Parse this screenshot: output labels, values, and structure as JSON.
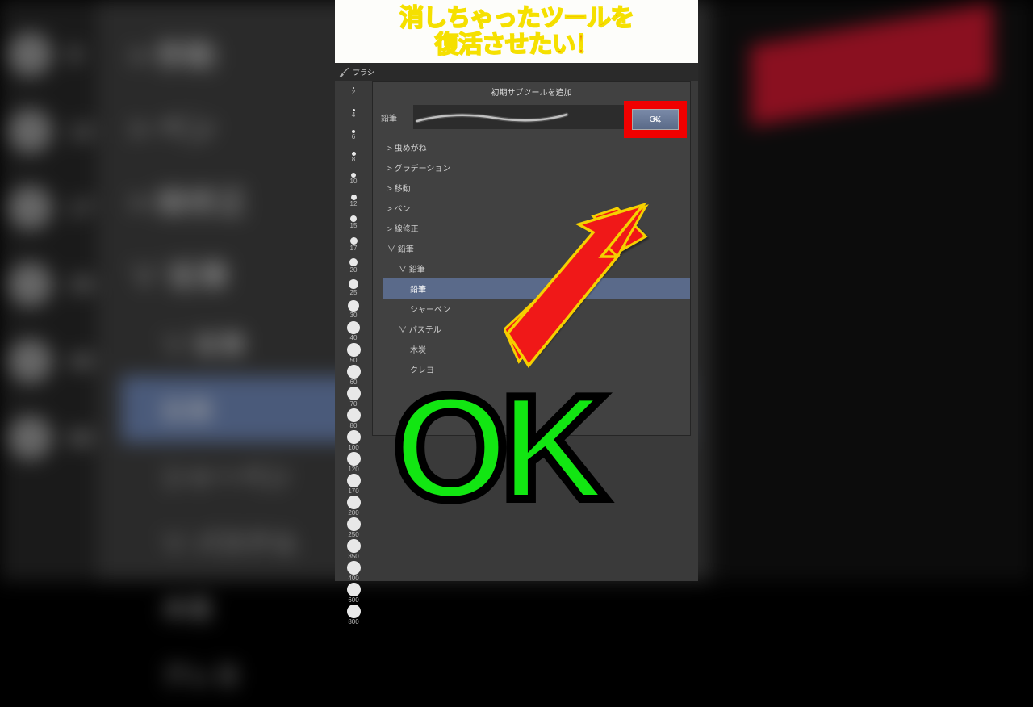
{
  "banner": {
    "line1": "消しちゃったツールを",
    "line2": "復活させたい！"
  },
  "tab": {
    "label": "ブラシ"
  },
  "dialog": {
    "title": "初期サブツールを追加",
    "preview_label": "鉛筆",
    "ok_label": "OK"
  },
  "tree": [
    {
      "label": "> 虫めがね",
      "indent": 0,
      "sel": false
    },
    {
      "label": "> グラデーション",
      "indent": 0,
      "sel": false
    },
    {
      "label": "> 移動",
      "indent": 0,
      "sel": false
    },
    {
      "label": "> ペン",
      "indent": 0,
      "sel": false
    },
    {
      "label": "> 線修正",
      "indent": 0,
      "sel": false
    },
    {
      "label": "∨ 鉛筆",
      "indent": 0,
      "sel": false
    },
    {
      "label": "∨ 鉛筆",
      "indent": 1,
      "sel": false
    },
    {
      "label": "鉛筆",
      "indent": 2,
      "sel": true
    },
    {
      "label": "シャーペン",
      "indent": 2,
      "sel": false
    },
    {
      "label": "∨ パステル",
      "indent": 1,
      "sel": false
    },
    {
      "label": "木炭",
      "indent": 2,
      "sel": false
    },
    {
      "label": "クレヨ",
      "indent": 2,
      "sel": false
    }
  ],
  "sizes": [
    {
      "n": "2",
      "d": 2
    },
    {
      "n": "4",
      "d": 3
    },
    {
      "n": "6",
      "d": 4
    },
    {
      "n": "8",
      "d": 5
    },
    {
      "n": "10",
      "d": 6
    },
    {
      "n": "12",
      "d": 7
    },
    {
      "n": "15",
      "d": 8
    },
    {
      "n": "17",
      "d": 9
    },
    {
      "n": "20",
      "d": 10
    },
    {
      "n": "25",
      "d": 12
    },
    {
      "n": "30",
      "d": 14
    },
    {
      "n": "40",
      "d": 16
    },
    {
      "n": "50",
      "d": 17
    },
    {
      "n": "60",
      "d": 17
    },
    {
      "n": "70",
      "d": 17
    },
    {
      "n": "80",
      "d": 17
    },
    {
      "n": "100",
      "d": 17
    },
    {
      "n": "120",
      "d": 17
    },
    {
      "n": "170",
      "d": 17
    },
    {
      "n": "200",
      "d": 17
    },
    {
      "n": "250",
      "d": 17
    },
    {
      "n": "350",
      "d": 17
    },
    {
      "n": "400",
      "d": 17
    },
    {
      "n": "600",
      "d": 17
    },
    {
      "n": "800",
      "d": 17
    }
  ],
  "bg": {
    "left_nums": [
      "8",
      "12",
      "17",
      "25",
      "40",
      "60"
    ],
    "list": [
      {
        "t": "> 移動",
        "cls": ""
      },
      {
        "t": "> ペン",
        "cls": ""
      },
      {
        "t": "> 線修正",
        "cls": ""
      },
      {
        "t": "∨ 鉛筆",
        "cls": ""
      },
      {
        "t": "∨ 鉛筆",
        "cls": "small"
      },
      {
        "t": "鉛筆",
        "cls": "small sel"
      },
      {
        "t": "シャーペン",
        "cls": "small"
      },
      {
        "t": "∨ パステル",
        "cls": "small"
      },
      {
        "t": "木炭",
        "cls": "small"
      },
      {
        "t": "クレヨ",
        "cls": "small"
      }
    ]
  },
  "big_ok": "OK"
}
